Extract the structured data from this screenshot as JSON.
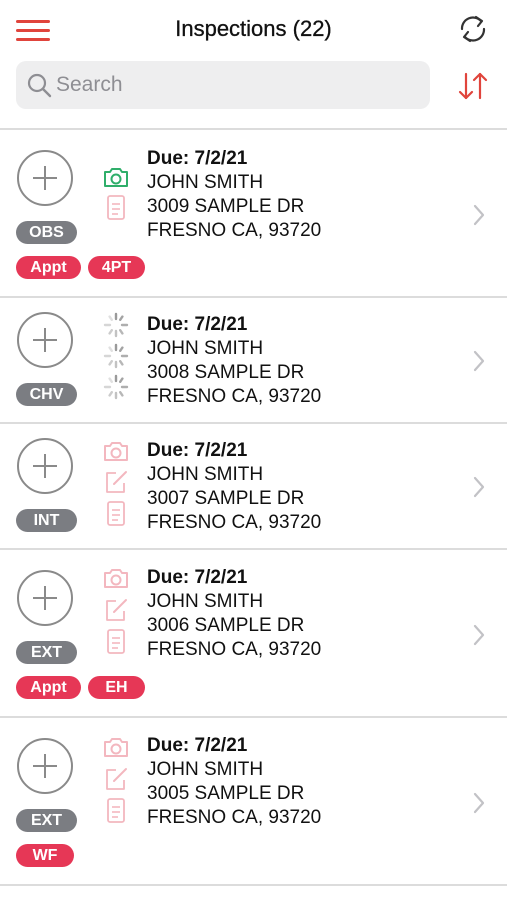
{
  "header": {
    "title": "Inspections (22)",
    "menu_icon": "hamburger-menu-icon",
    "refresh_icon": "refresh-icon",
    "accent_color": "#e0443c"
  },
  "search": {
    "placeholder": "Search",
    "value": "",
    "sort_icon": "sort-arrows-icon"
  },
  "inspections": [
    {
      "due": "Due: 7/2/21",
      "name": "JOHN SMITH",
      "street": "3009 SAMPLE DR",
      "city": "FRESNO CA, 93720",
      "type": "OBS",
      "tags": [
        "Appt",
        "4PT"
      ],
      "status_icons": [
        "camera-icon-green",
        "document-icon"
      ]
    },
    {
      "due": "Due: 7/2/21",
      "name": "JOHN SMITH",
      "street": "3008 SAMPLE DR",
      "city": "FRESNO CA, 93720",
      "type": "CHV",
      "tags": [],
      "status_icons": [
        "loading-spinner-icon",
        "loading-spinner-icon",
        "loading-spinner-icon"
      ]
    },
    {
      "due": "Due: 7/2/21",
      "name": "JOHN SMITH",
      "street": "3007 SAMPLE DR",
      "city": "FRESNO CA, 93720",
      "type": "INT",
      "tags": [],
      "status_icons": [
        "camera-icon",
        "edit-icon",
        "document-icon"
      ]
    },
    {
      "due": "Due: 7/2/21",
      "name": "JOHN SMITH",
      "street": "3006 SAMPLE DR",
      "city": "FRESNO CA, 93720",
      "type": "EXT",
      "tags": [
        "Appt",
        "EH"
      ],
      "status_icons": [
        "camera-icon",
        "edit-icon",
        "document-icon"
      ]
    },
    {
      "due": "Due: 7/2/21",
      "name": "JOHN SMITH",
      "street": "3005 SAMPLE DR",
      "city": "FRESNO CA, 93720",
      "type": "EXT",
      "tags": [
        "WF"
      ],
      "status_icons": [
        "camera-icon",
        "edit-icon",
        "document-icon"
      ]
    }
  ],
  "colors": {
    "tag_red": "#e63756",
    "type_gray": "#7b7d82",
    "icon_faded": "#f3b7bf",
    "icon_green": "#2fae6a",
    "divider": "#dcdcdc"
  }
}
